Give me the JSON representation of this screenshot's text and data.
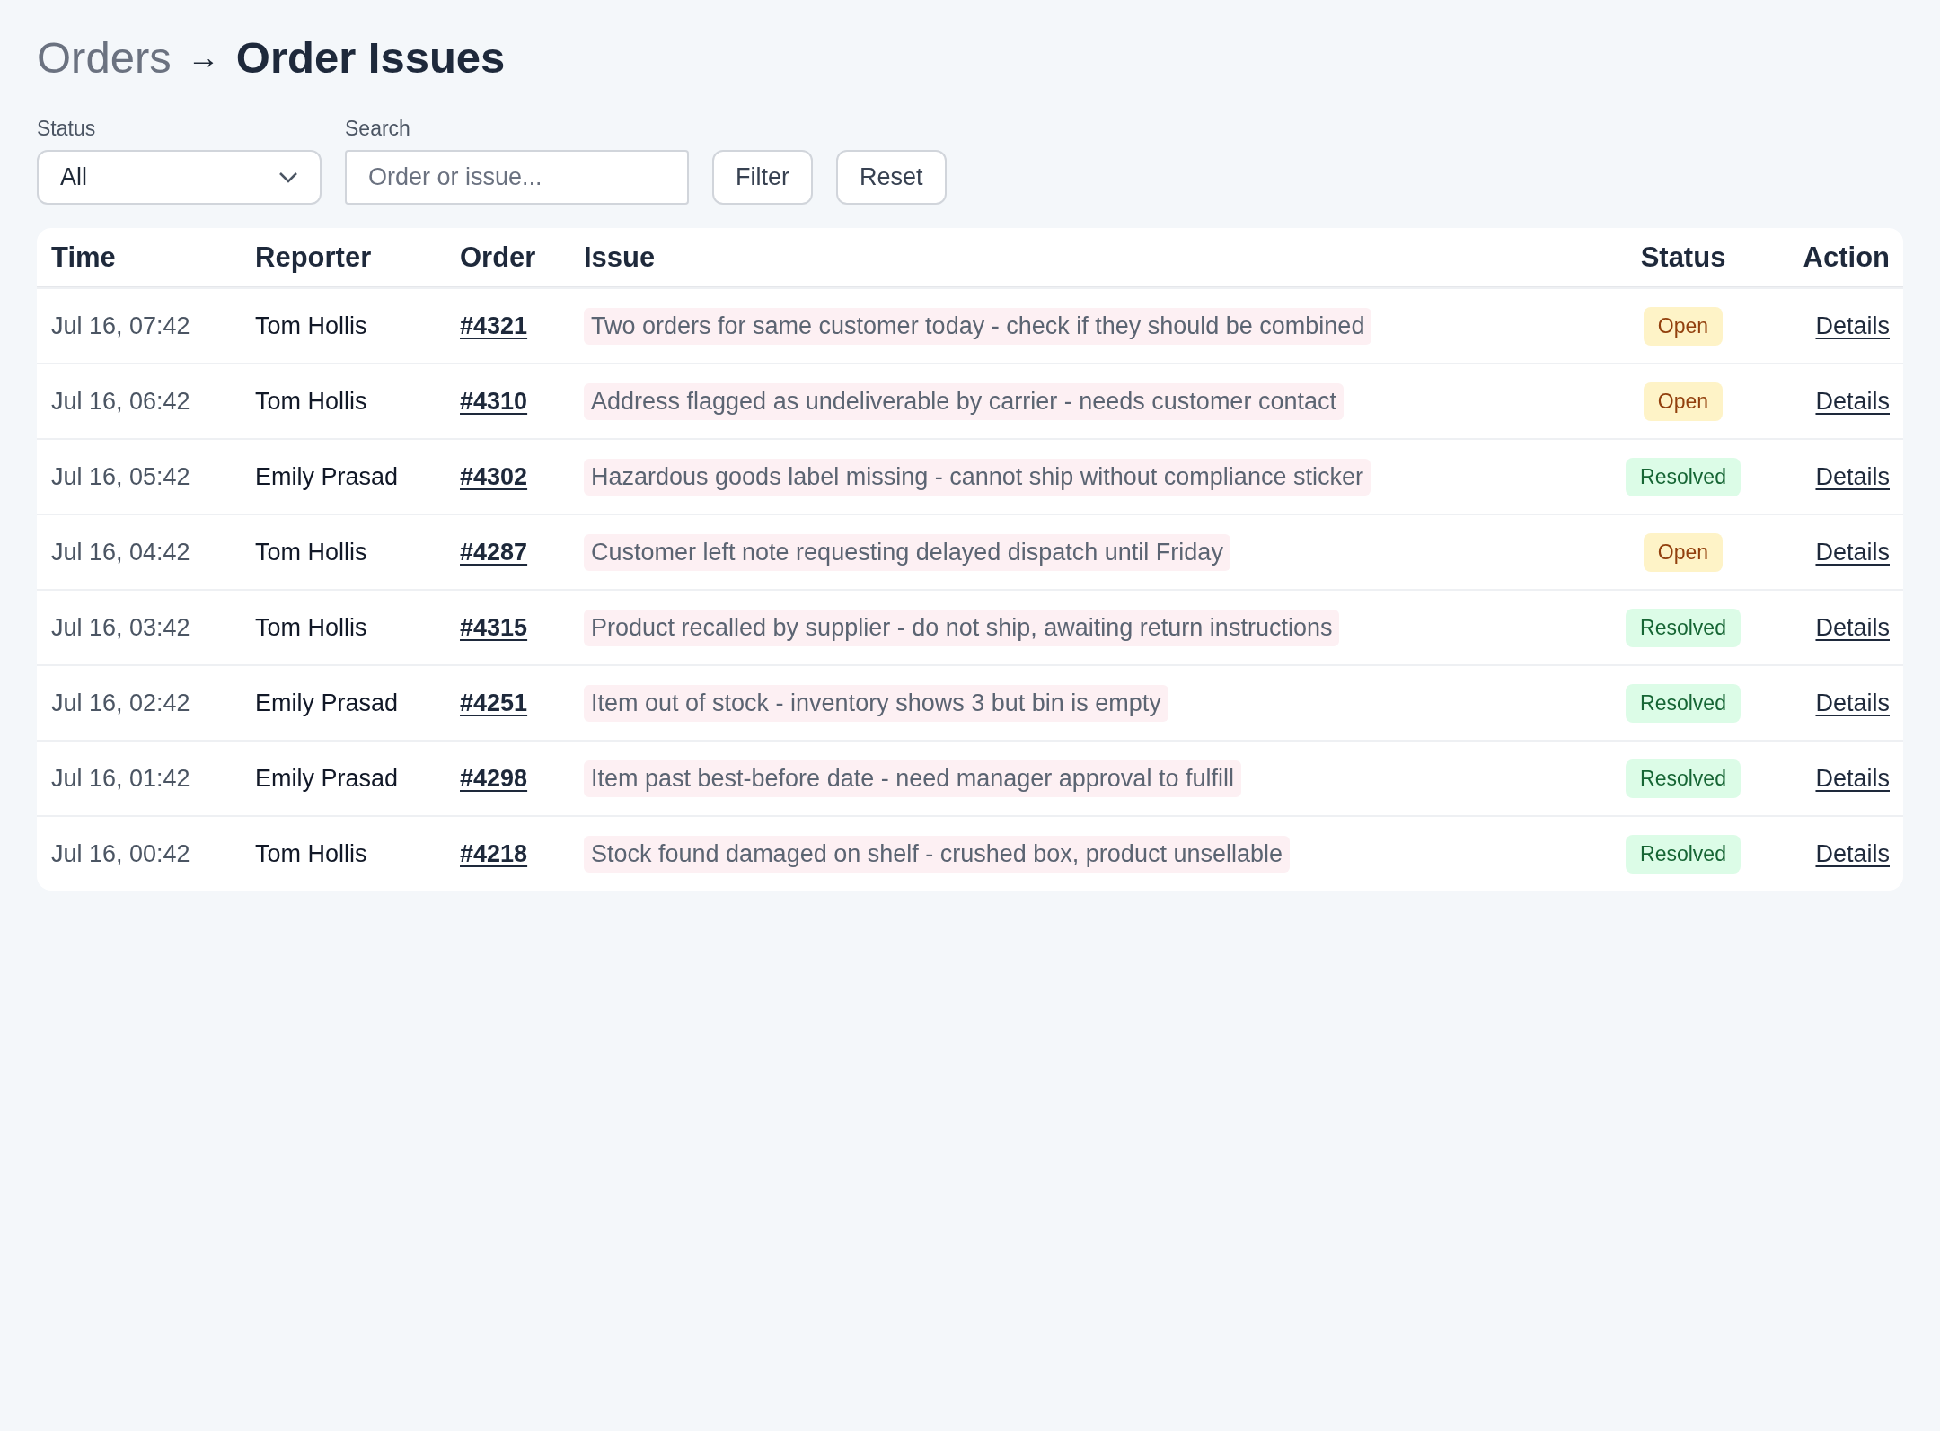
{
  "breadcrumb": {
    "parent": "Orders",
    "separator": "→",
    "current": "Order Issues"
  },
  "filters": {
    "status": {
      "label": "Status",
      "value": "All"
    },
    "search": {
      "label": "Search",
      "placeholder": "Order or issue..."
    },
    "buttons": [
      "Filter",
      "Reset"
    ]
  },
  "table": {
    "columns": [
      "Time",
      "Reporter",
      "Order",
      "Issue",
      "Status",
      "Action"
    ],
    "rows": [
      {
        "time": "Jul 16, 07:42",
        "reporter": "Tom Hollis",
        "order": "#4321",
        "issue": "Two orders for same customer today - check if they should be combined",
        "status": {
          "label": "Open",
          "kind": "open"
        },
        "action": "Details"
      },
      {
        "time": "Jul 16, 06:42",
        "reporter": "Tom Hollis",
        "order": "#4310",
        "issue": "Address flagged as undeliverable by carrier - needs customer contact",
        "status": {
          "label": "Open",
          "kind": "open"
        },
        "action": "Details"
      },
      {
        "time": "Jul 16, 05:42",
        "reporter": "Emily Prasad",
        "order": "#4302",
        "issue": "Hazardous goods label missing - cannot ship without compliance sticker",
        "status": {
          "label": "Resolved",
          "kind": "resolved"
        },
        "action": "Details"
      },
      {
        "time": "Jul 16, 04:42",
        "reporter": "Tom Hollis",
        "order": "#4287",
        "issue": "Customer left note requesting delayed dispatch until Friday",
        "status": {
          "label": "Open",
          "kind": "open"
        },
        "action": "Details"
      },
      {
        "time": "Jul 16, 03:42",
        "reporter": "Tom Hollis",
        "order": "#4315",
        "issue": "Product recalled by supplier - do not ship, awaiting return instructions",
        "status": {
          "label": "Resolved",
          "kind": "resolved"
        },
        "action": "Details"
      },
      {
        "time": "Jul 16, 02:42",
        "reporter": "Emily Prasad",
        "order": "#4251",
        "issue": "Item out of stock - inventory shows 3 but bin is empty",
        "status": {
          "label": "Resolved",
          "kind": "resolved"
        },
        "action": "Details"
      },
      {
        "time": "Jul 16, 01:42",
        "reporter": "Emily Prasad",
        "order": "#4298",
        "issue": "Item past best-before date - need manager approval to fulfill",
        "status": {
          "label": "Resolved",
          "kind": "resolved"
        },
        "action": "Details"
      },
      {
        "time": "Jul 16, 00:42",
        "reporter": "Tom Hollis",
        "order": "#4218",
        "issue": "Stock found damaged on shelf - crushed box, product unsellable",
        "status": {
          "label": "Resolved",
          "kind": "resolved"
        },
        "action": "Details"
      }
    ]
  }
}
